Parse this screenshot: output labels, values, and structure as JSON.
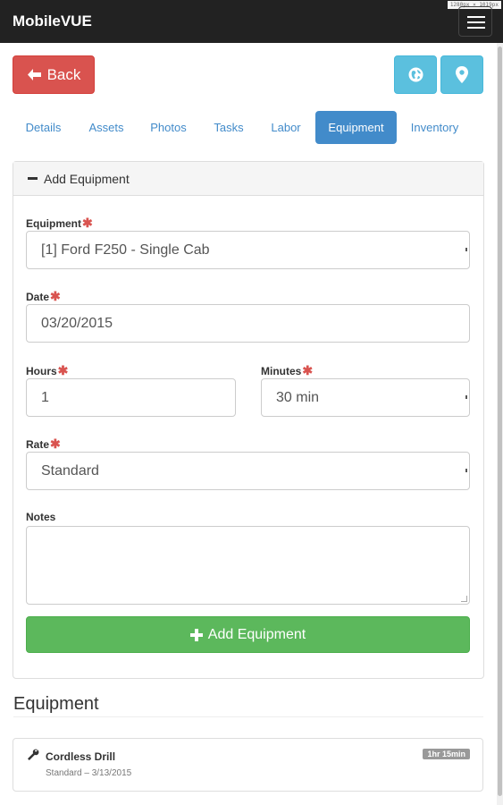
{
  "app": {
    "title": "MobileVUE",
    "viewport_readout": "1280px × 1019px"
  },
  "nav": {
    "back_label": "Back"
  },
  "tabs": [
    {
      "label": "Details"
    },
    {
      "label": "Assets"
    },
    {
      "label": "Photos"
    },
    {
      "label": "Tasks"
    },
    {
      "label": "Labor"
    },
    {
      "label": "Equipment"
    },
    {
      "label": "Inventory"
    }
  ],
  "active_tab": "Equipment",
  "form": {
    "panel_title": "Add Equipment",
    "required_marker": "✱",
    "equipment": {
      "label": "Equipment",
      "value": "[1] Ford F250 - Single Cab"
    },
    "date": {
      "label": "Date",
      "value": "03/20/2015"
    },
    "hours": {
      "label": "Hours",
      "value": "1"
    },
    "minutes": {
      "label": "Minutes",
      "value": "30 min"
    },
    "rate": {
      "label": "Rate",
      "value": "Standard"
    },
    "notes": {
      "label": "Notes",
      "value": ""
    },
    "submit_label": "Add Equipment"
  },
  "equipment_list": {
    "heading": "Equipment",
    "items": [
      {
        "name": "Cordless Drill",
        "meta": "Standard – 3/13/2015",
        "duration": "1hr 15min"
      }
    ]
  },
  "colors": {
    "topbar": "#222222",
    "danger": "#d9534f",
    "info": "#5bc0de",
    "primary": "#428bca",
    "success": "#5cb85c",
    "required": "#d9534f"
  },
  "icons": {
    "back": "arrow-left-icon",
    "globe": "globe-icon",
    "pin": "map-marker-icon",
    "menu": "hamburger-menu-icon",
    "collapse": "minus-icon",
    "add": "plus-icon",
    "item": "wrench-icon"
  }
}
